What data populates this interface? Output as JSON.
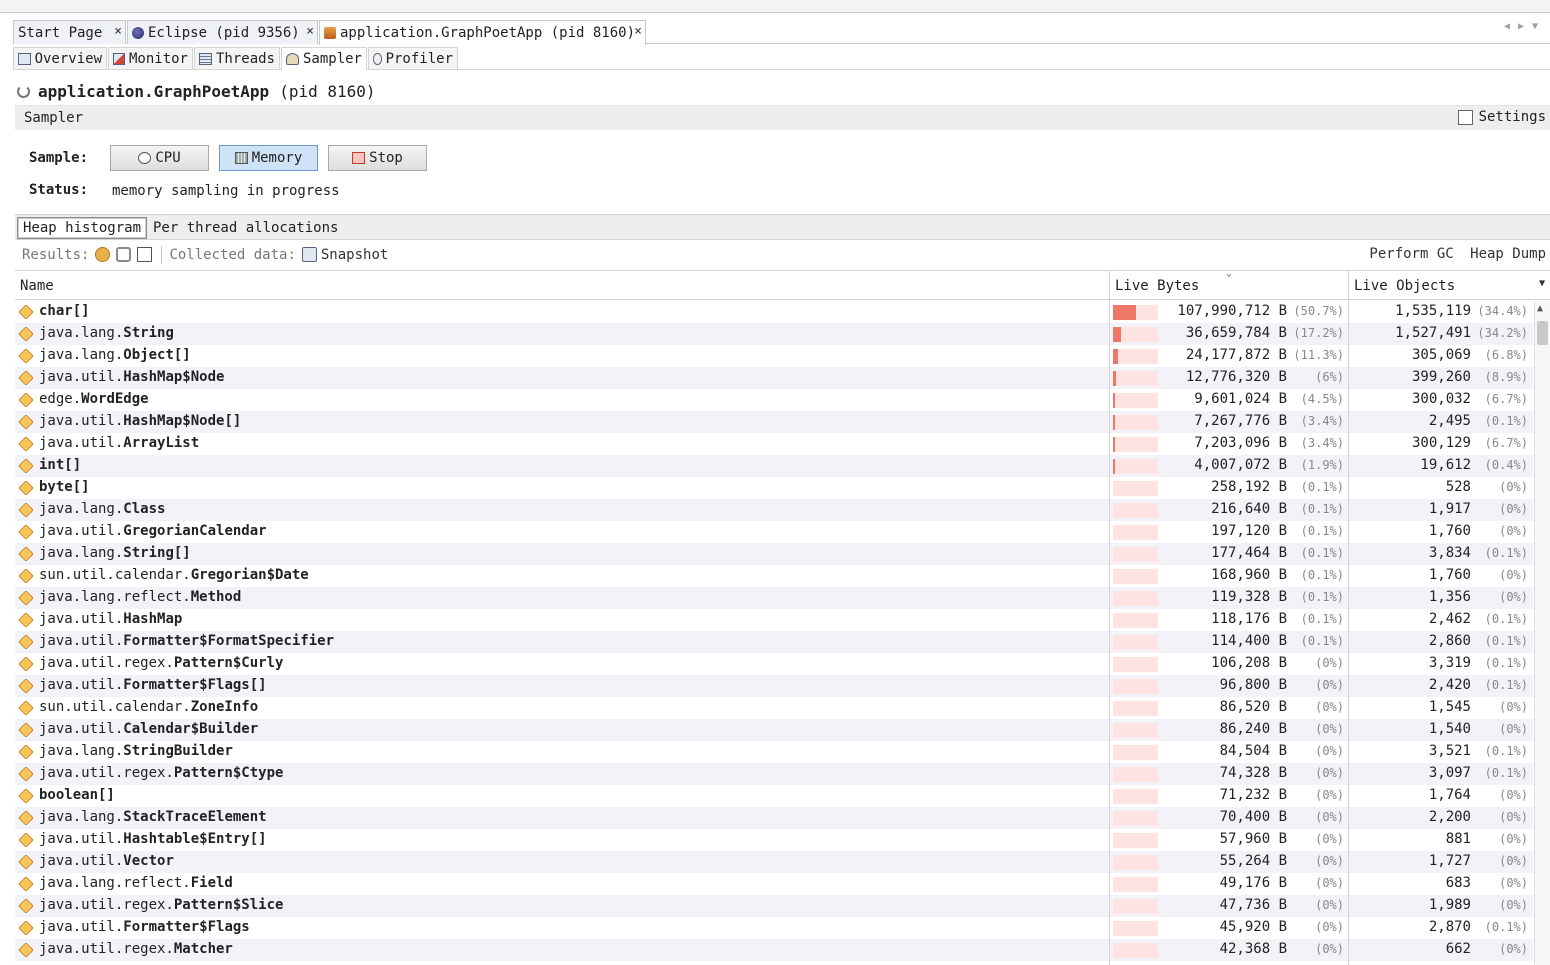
{
  "doc_tabs": [
    {
      "label": "Start Page",
      "close": "×"
    },
    {
      "label": "Eclipse (pid 9356)",
      "close": "×"
    },
    {
      "label": "application.GraphPoetApp (pid 8160)",
      "close": "×"
    }
  ],
  "view_tabs": [
    "Overview",
    "Monitor",
    "Threads",
    "Sampler",
    "Profiler"
  ],
  "active_view_tab": "Sampler",
  "app": {
    "name": "application.GraphPoetApp",
    "pid": "(pid 8160)"
  },
  "section": {
    "title": "Sampler",
    "settings_label": "Settings"
  },
  "sample": {
    "label": "Sample:",
    "buttons": {
      "cpu": "CPU",
      "memory": "Memory",
      "stop": "Stop"
    },
    "pressed": "Memory",
    "status_label": "Status:",
    "status_value": "memory sampling in progress"
  },
  "sub_tabs": [
    "Heap histogram",
    "Per thread allocations"
  ],
  "toolbar": {
    "results_label": "Results:",
    "collected_label": "Collected data:",
    "snapshot_label": "Snapshot",
    "perform_gc": "Perform GC",
    "heap_dump": "Heap Dump"
  },
  "columns": {
    "name": "Name",
    "live_bytes": "Live Bytes",
    "live_objects": "Live Objects"
  },
  "colors": {
    "bar": "#ef7767",
    "bar_bg": "#fde4e2",
    "pressed_button": "#cfe3f7"
  },
  "rows": [
    {
      "pkg": "",
      "cls": "char[]",
      "bytes": "107,990,712 B",
      "bpct": "(50.7%)",
      "bfrac": 0.507,
      "objs": "1,535,119",
      "opct": "(34.4%)"
    },
    {
      "pkg": "java.lang.",
      "cls": "String",
      "bytes": "36,659,784 B",
      "bpct": "(17.2%)",
      "bfrac": 0.172,
      "objs": "1,527,491",
      "opct": "(34.2%)"
    },
    {
      "pkg": "java.lang.",
      "cls": "Object[]",
      "bytes": "24,177,872 B",
      "bpct": "(11.3%)",
      "bfrac": 0.113,
      "objs": "305,069",
      "opct": "(6.8%)"
    },
    {
      "pkg": "java.util.",
      "cls": "HashMap$Node",
      "bytes": "12,776,320 B",
      "bpct": "(6%)",
      "bfrac": 0.06,
      "objs": "399,260",
      "opct": "(8.9%)"
    },
    {
      "pkg": "edge.",
      "cls": "WordEdge",
      "bytes": "9,601,024 B",
      "bpct": "(4.5%)",
      "bfrac": 0.045,
      "objs": "300,032",
      "opct": "(6.7%)"
    },
    {
      "pkg": "java.util.",
      "cls": "HashMap$Node[]",
      "bytes": "7,267,776 B",
      "bpct": "(3.4%)",
      "bfrac": 0.034,
      "objs": "2,495",
      "opct": "(0.1%)"
    },
    {
      "pkg": "java.util.",
      "cls": "ArrayList",
      "bytes": "7,203,096 B",
      "bpct": "(3.4%)",
      "bfrac": 0.034,
      "objs": "300,129",
      "opct": "(6.7%)"
    },
    {
      "pkg": "",
      "cls": "int[]",
      "bytes": "4,007,072 B",
      "bpct": "(1.9%)",
      "bfrac": 0.019,
      "objs": "19,612",
      "opct": "(0.4%)"
    },
    {
      "pkg": "",
      "cls": "byte[]",
      "bytes": "258,192 B",
      "bpct": "(0.1%)",
      "bfrac": 0.001,
      "objs": "528",
      "opct": "(0%)"
    },
    {
      "pkg": "java.lang.",
      "cls": "Class",
      "bytes": "216,640 B",
      "bpct": "(0.1%)",
      "bfrac": 0.001,
      "objs": "1,917",
      "opct": "(0%)"
    },
    {
      "pkg": "java.util.",
      "cls": "GregorianCalendar",
      "bytes": "197,120 B",
      "bpct": "(0.1%)",
      "bfrac": 0.001,
      "objs": "1,760",
      "opct": "(0%)"
    },
    {
      "pkg": "java.lang.",
      "cls": "String[]",
      "bytes": "177,464 B",
      "bpct": "(0.1%)",
      "bfrac": 0.001,
      "objs": "3,834",
      "opct": "(0.1%)"
    },
    {
      "pkg": "sun.util.calendar.",
      "cls": "Gregorian$Date",
      "bytes": "168,960 B",
      "bpct": "(0.1%)",
      "bfrac": 0.001,
      "objs": "1,760",
      "opct": "(0%)"
    },
    {
      "pkg": "java.lang.reflect.",
      "cls": "Method",
      "bytes": "119,328 B",
      "bpct": "(0.1%)",
      "bfrac": 0.001,
      "objs": "1,356",
      "opct": "(0%)"
    },
    {
      "pkg": "java.util.",
      "cls": "HashMap",
      "bytes": "118,176 B",
      "bpct": "(0.1%)",
      "bfrac": 0.001,
      "objs": "2,462",
      "opct": "(0.1%)"
    },
    {
      "pkg": "java.util.",
      "cls": "Formatter$FormatSpecifier",
      "bytes": "114,400 B",
      "bpct": "(0.1%)",
      "bfrac": 0.001,
      "objs": "2,860",
      "opct": "(0.1%)"
    },
    {
      "pkg": "java.util.regex.",
      "cls": "Pattern$Curly",
      "bytes": "106,208 B",
      "bpct": "(0%)",
      "bfrac": 0,
      "objs": "3,319",
      "opct": "(0.1%)"
    },
    {
      "pkg": "java.util.",
      "cls": "Formatter$Flags[]",
      "bytes": "96,800 B",
      "bpct": "(0%)",
      "bfrac": 0,
      "objs": "2,420",
      "opct": "(0.1%)"
    },
    {
      "pkg": "sun.util.calendar.",
      "cls": "ZoneInfo",
      "bytes": "86,520 B",
      "bpct": "(0%)",
      "bfrac": 0,
      "objs": "1,545",
      "opct": "(0%)"
    },
    {
      "pkg": "java.util.",
      "cls": "Calendar$Builder",
      "bytes": "86,240 B",
      "bpct": "(0%)",
      "bfrac": 0,
      "objs": "1,540",
      "opct": "(0%)"
    },
    {
      "pkg": "java.lang.",
      "cls": "StringBuilder",
      "bytes": "84,504 B",
      "bpct": "(0%)",
      "bfrac": 0,
      "objs": "3,521",
      "opct": "(0.1%)"
    },
    {
      "pkg": "java.util.regex.",
      "cls": "Pattern$Ctype",
      "bytes": "74,328 B",
      "bpct": "(0%)",
      "bfrac": 0,
      "objs": "3,097",
      "opct": "(0.1%)"
    },
    {
      "pkg": "",
      "cls": "boolean[]",
      "bytes": "71,232 B",
      "bpct": "(0%)",
      "bfrac": 0,
      "objs": "1,764",
      "opct": "(0%)"
    },
    {
      "pkg": "java.lang.",
      "cls": "StackTraceElement",
      "bytes": "70,400 B",
      "bpct": "(0%)",
      "bfrac": 0,
      "objs": "2,200",
      "opct": "(0%)"
    },
    {
      "pkg": "java.util.",
      "cls": "Hashtable$Entry[]",
      "bytes": "57,960 B",
      "bpct": "(0%)",
      "bfrac": 0,
      "objs": "881",
      "opct": "(0%)"
    },
    {
      "pkg": "java.util.",
      "cls": "Vector",
      "bytes": "55,264 B",
      "bpct": "(0%)",
      "bfrac": 0,
      "objs": "1,727",
      "opct": "(0%)"
    },
    {
      "pkg": "java.lang.reflect.",
      "cls": "Field",
      "bytes": "49,176 B",
      "bpct": "(0%)",
      "bfrac": 0,
      "objs": "683",
      "opct": "(0%)"
    },
    {
      "pkg": "java.util.regex.",
      "cls": "Pattern$Slice",
      "bytes": "47,736 B",
      "bpct": "(0%)",
      "bfrac": 0,
      "objs": "1,989",
      "opct": "(0%)"
    },
    {
      "pkg": "java.util.",
      "cls": "Formatter$Flags",
      "bytes": "45,920 B",
      "bpct": "(0%)",
      "bfrac": 0,
      "objs": "2,870",
      "opct": "(0.1%)"
    },
    {
      "pkg": "java.util.regex.",
      "cls": "Matcher",
      "bytes": "42,368 B",
      "bpct": "(0%)",
      "bfrac": 0,
      "objs": "662",
      "opct": "(0%)"
    }
  ]
}
